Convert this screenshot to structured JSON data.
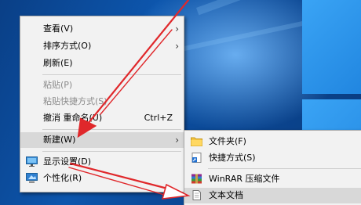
{
  "context_menu": {
    "items": [
      {
        "label": "查看(V)"
      },
      {
        "label": "排序方式(O)"
      },
      {
        "label": "刷新(E)"
      },
      {
        "label": "粘贴(P)"
      },
      {
        "label": "粘贴快捷方式(S)"
      },
      {
        "label": "撤消 重命名(U)",
        "shortcut": "Ctrl+Z"
      },
      {
        "label": "新建(W)"
      },
      {
        "label": "显示设置(D)"
      },
      {
        "label": "个性化(R)"
      }
    ],
    "submenu_arrow": "›"
  },
  "new_submenu": {
    "items": [
      {
        "label": "文件夹(F)",
        "icon": "folder-icon"
      },
      {
        "label": "快捷方式(S)",
        "icon": "shortcut-icon"
      },
      {
        "label": "WinRAR 压缩文件",
        "icon": "winrar-archive-icon"
      },
      {
        "label": "文本文档",
        "icon": "text-document-icon"
      }
    ]
  },
  "colors": {
    "arrow_annotation": "#e0282b",
    "highlight": "#d8d8d8"
  }
}
